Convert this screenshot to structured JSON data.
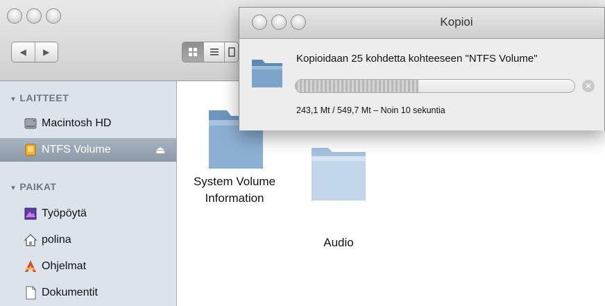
{
  "finder": {
    "nav": {
      "back_icon": "◀",
      "forward_icon": "▶"
    },
    "view_buttons": [
      "icon-view",
      "list-view",
      "column-view"
    ],
    "sidebar": {
      "sections": [
        {
          "title": "LAITTEET",
          "items": [
            "Macintosh HD",
            "NTFS Volume"
          ]
        },
        {
          "title": "PAIKAT",
          "items": [
            "Työpöytä",
            "polina",
            "Ohjelmat",
            "Dokumentit"
          ]
        }
      ],
      "selected": "NTFS Volume"
    },
    "content": {
      "items": [
        {
          "label_line1": "System Volume",
          "label_line2": "Information"
        },
        {
          "label_line1": "Audio",
          "label_line2": ""
        }
      ]
    }
  },
  "dialog": {
    "title": "Kopioi",
    "message": "Kopioidaan 25 kohdetta kohteeseen \"NTFS Volume\"",
    "status": "243,1 Mt / 549,7 Mt – Noin 10 sekuntia",
    "progress": 0.44
  },
  "colors": {
    "sidebar_bg": "#dde3ea",
    "selection": "#8d99a7",
    "folder_blue": "#7ea4c9"
  }
}
